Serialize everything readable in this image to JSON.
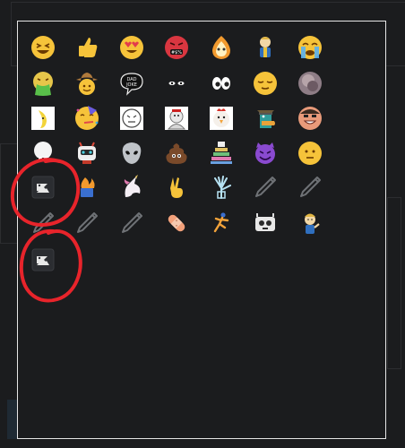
{
  "colors": {
    "background": "#1b1c1e",
    "panel_border": "#e6e6e6",
    "annotation": "#e8242b",
    "emoji_yellow": "#f6c33a"
  },
  "emoji_grid": {
    "columns": 7,
    "rows": [
      [
        "grinning-squint-face",
        "thumbs-up",
        "heart-eyes-face",
        "face-with-symbols",
        "fire-cartoon-character",
        "vault-boy",
        "crying-face"
      ],
      [
        "vomiting-face",
        "cowboy-face",
        "dad-joke-speech-bubble",
        "eyes-in-dark",
        "eyes",
        "relieved-face",
        "blurry-photo-face"
      ],
      [
        "banana-character",
        "partying-face",
        "sketch-cartoon-face",
        "cartoon-character-sticker",
        "chicken-face",
        "perry-platypus-agent",
        "grinning-cartoon-man"
      ],
      [
        "ghost-cup",
        "robot-face",
        "alien",
        "pile-of-poo",
        "rainbow-cake",
        "smiling-imp",
        "neutral-face"
      ],
      [
        "broken-image-icon",
        "trash-fire",
        "unicorn",
        "victory-hand",
        "xray-hand",
        "loading-pen-icon",
        "loading-pen-icon"
      ],
      [
        "loading-pen-icon",
        "loading-pen-icon",
        "loading-pen-icon",
        "bandage",
        "sprinting-stick-figure",
        "robot-face-alt",
        "vault-boy-thumbs-up"
      ],
      [
        "broken-image-icon"
      ]
    ]
  }
}
